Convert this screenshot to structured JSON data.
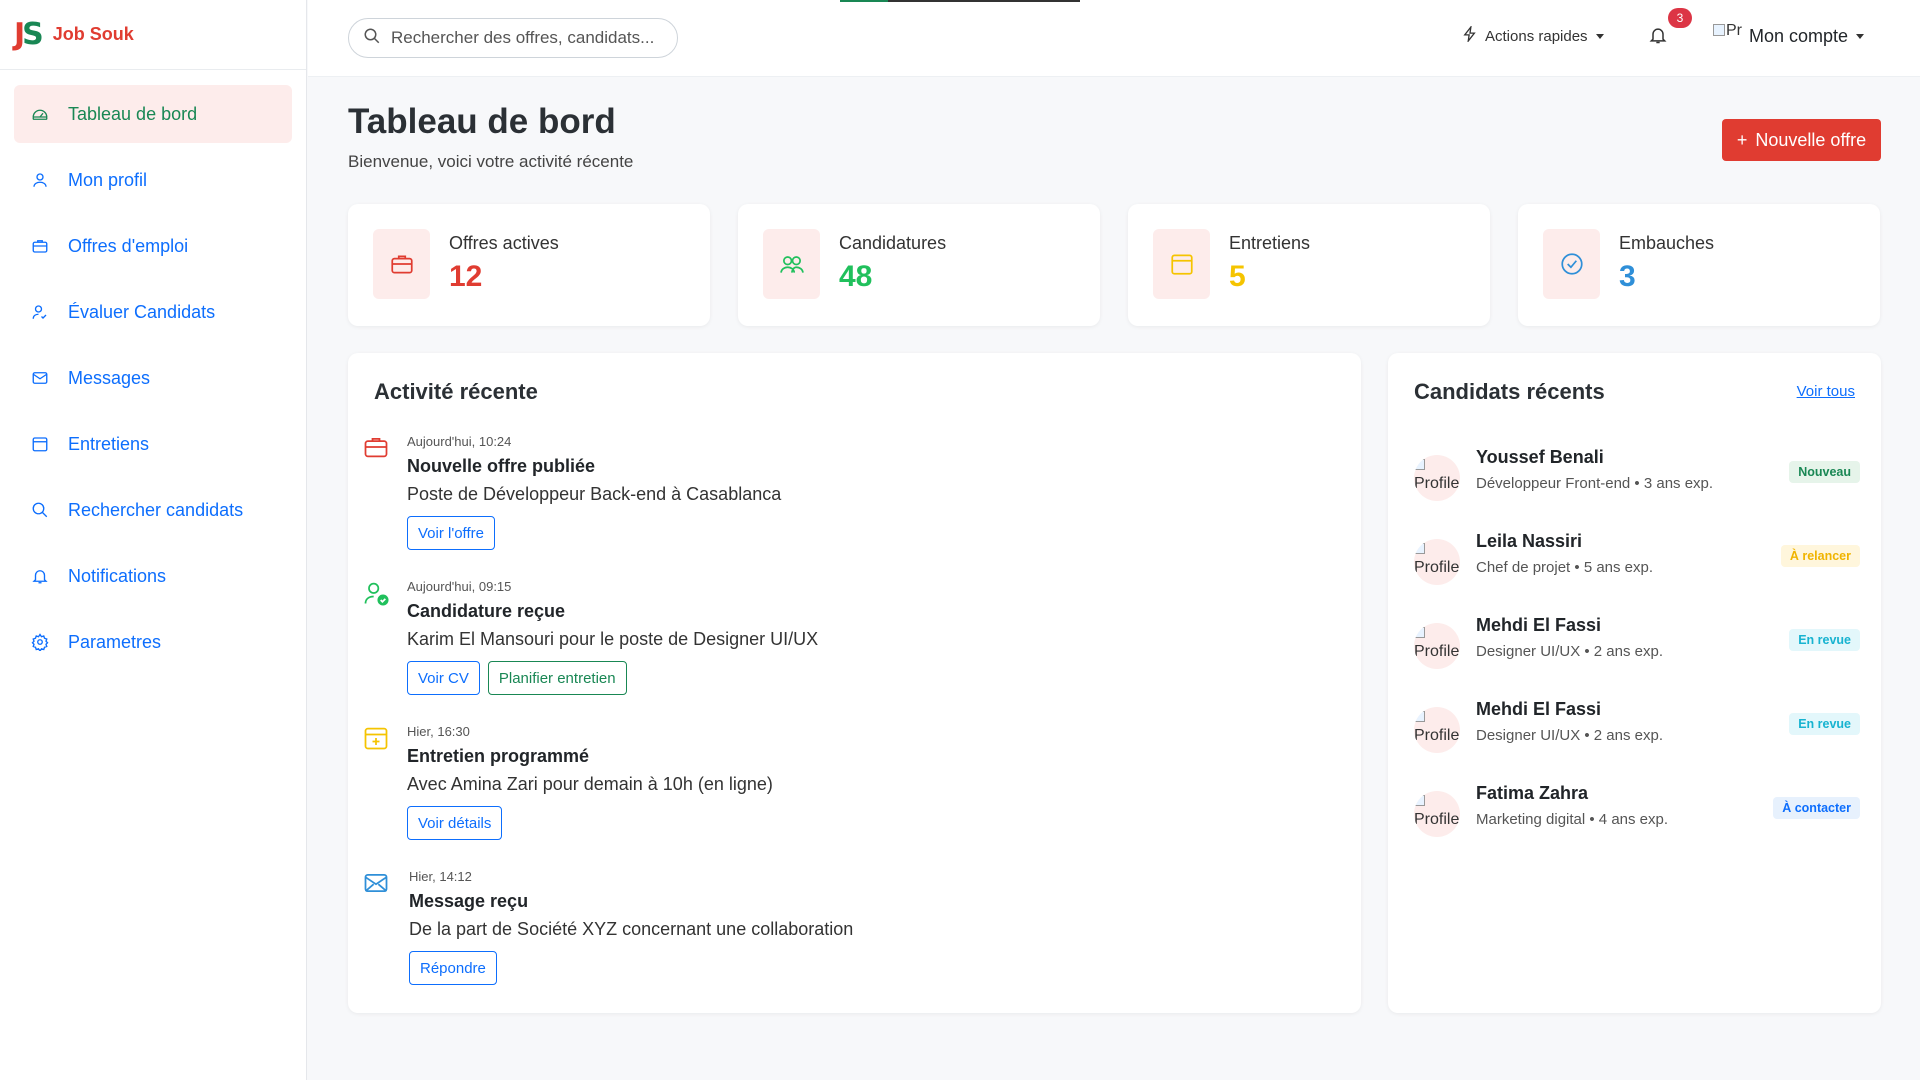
{
  "brand": {
    "logo_j": "J",
    "logo_s": "S",
    "name": "Job Souk"
  },
  "sidebar": {
    "items": [
      {
        "label": "Tableau de bord",
        "icon": "gauge-icon"
      },
      {
        "label": "Mon profil",
        "icon": "user-icon"
      },
      {
        "label": "Offres d'emploi",
        "icon": "briefcase-icon"
      },
      {
        "label": "Évaluer Candidats",
        "icon": "user-check-icon"
      },
      {
        "label": "Messages",
        "icon": "envelope-icon"
      },
      {
        "label": "Entretiens",
        "icon": "calendar-icon"
      },
      {
        "label": "Rechercher candidats",
        "icon": "search-icon"
      },
      {
        "label": "Notifications",
        "icon": "bell-icon"
      },
      {
        "label": "Parametres",
        "icon": "gear-icon"
      }
    ]
  },
  "topbar": {
    "search_placeholder": "Rechercher des offres, candidats...",
    "quick_actions": "Actions rapides",
    "notif_count": "3",
    "avatar_alt": "Pr",
    "account": "Mon compte"
  },
  "header": {
    "title": "Tableau de bord",
    "subtitle": "Bienvenue, voici votre activité récente",
    "new_offer": "Nouvelle offre"
  },
  "stats": [
    {
      "label": "Offres actives",
      "value": "12",
      "color": "#e03c31",
      "icon": "briefcase-icon"
    },
    {
      "label": "Candidatures",
      "value": "48",
      "color": "#20c05c",
      "icon": "users-icon"
    },
    {
      "label": "Entretiens",
      "value": "5",
      "color": "#f5c400",
      "icon": "calendar-icon"
    },
    {
      "label": "Embauches",
      "value": "3",
      "color": "#2f8fd8",
      "icon": "check-circle-icon"
    }
  ],
  "activity": {
    "title": "Activité récente",
    "items": [
      {
        "time": "Aujourd'hui, 10:24",
        "title": "Nouvelle offre publiée",
        "desc": "Poste de Développeur Back-end à Casablanca",
        "buttons": [
          "Voir l'offre"
        ]
      },
      {
        "time": "Aujourd'hui, 09:15",
        "title": "Candidature reçue",
        "desc": "Karim El Mansouri pour le poste de Designer UI/UX",
        "buttons": [
          "Voir CV",
          "Planifier entretien"
        ]
      },
      {
        "time": "Hier, 16:30",
        "title": "Entretien programmé",
        "desc": "Avec Amina Zari pour demain à 10h (en ligne)",
        "buttons": [
          "Voir détails"
        ]
      },
      {
        "time": "Hier, 14:12",
        "title": "Message reçu",
        "desc": "De la part de Société XYZ concernant une collaboration",
        "buttons": [
          "Répondre"
        ]
      }
    ]
  },
  "candidates": {
    "title": "Candidats récents",
    "see_all": "Voir tous",
    "avatar_alt": "Profile",
    "items": [
      {
        "name": "Youssef Benali",
        "meta": "Développeur Front-end • 3 ans exp.",
        "status": "Nouveau",
        "bg": "#e6f4ea",
        "fg": "#198754"
      },
      {
        "name": "Leila Nassiri",
        "meta": "Chef de projet • 5 ans exp.",
        "status": "À relancer",
        "bg": "#fff6dc",
        "fg": "#f0b400"
      },
      {
        "name": "Mehdi El Fassi",
        "meta": "Designer UI/UX • 2 ans exp.",
        "status": "En revue",
        "bg": "#e3f7fb",
        "fg": "#17b3d0"
      },
      {
        "name": "Mehdi El Fassi",
        "meta": "Designer UI/UX • 2 ans exp.",
        "status": "En revue",
        "bg": "#e3f7fb",
        "fg": "#17b3d0"
      },
      {
        "name": "Fatima Zahra",
        "meta": "Marketing digital • 4 ans exp.",
        "status": "À contacter",
        "bg": "#e7f1fd",
        "fg": "#0d6efd"
      }
    ]
  }
}
